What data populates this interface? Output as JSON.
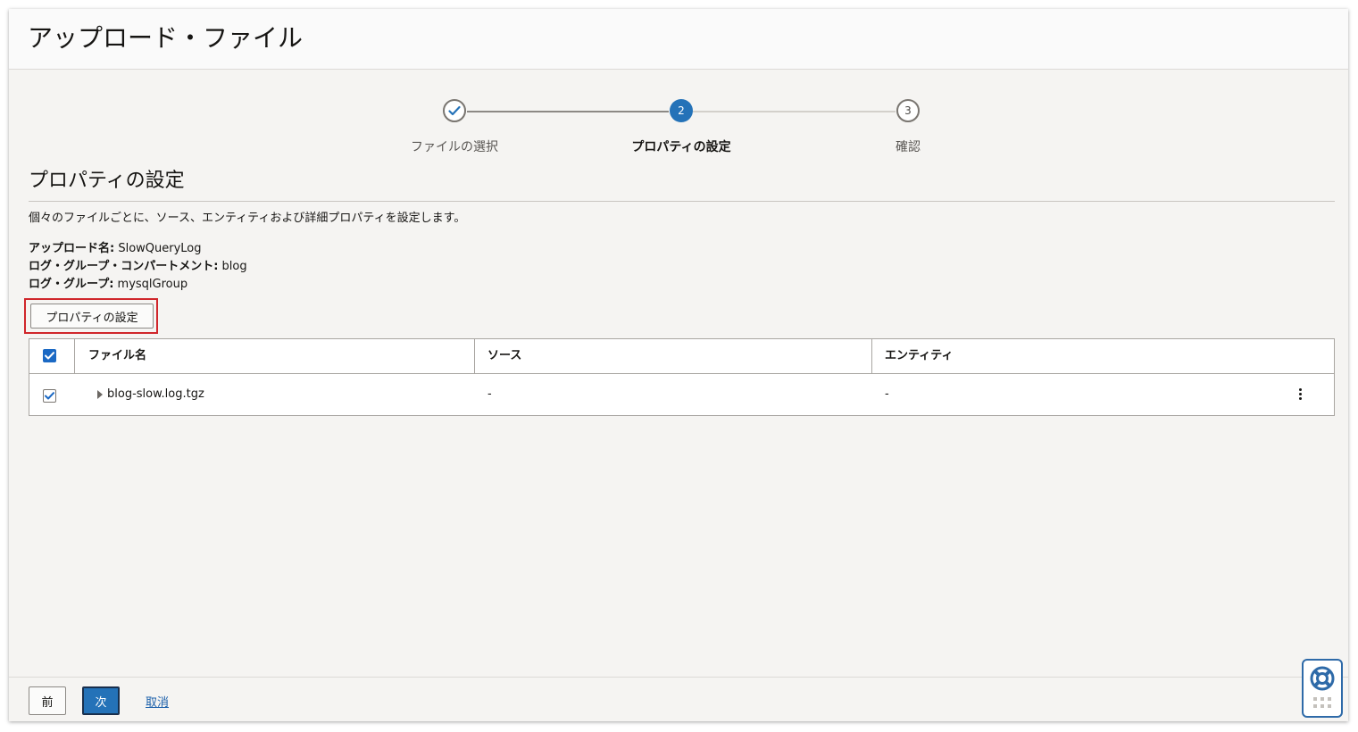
{
  "page": {
    "title": "アップロード・ファイル"
  },
  "stepper": {
    "steps": [
      {
        "label": "ファイルの選択",
        "state": "done"
      },
      {
        "label": "プロパティの設定",
        "state": "current",
        "number": "2"
      },
      {
        "label": "確認",
        "state": "todo",
        "number": "3"
      }
    ]
  },
  "section": {
    "title": "プロパティの設定",
    "description": "個々のファイルごとに、ソース、エンティティおよび詳細プロパティを設定します。"
  },
  "meta": {
    "upload_name_label": "アップロード名:",
    "upload_name_value": " SlowQueryLog",
    "compartment_label": "ログ・グループ・コンパートメント:",
    "compartment_value": " blog",
    "log_group_label": "ログ・グループ:",
    "log_group_value": " mysqlGroup"
  },
  "actions": {
    "set_properties_label": "プロパティの設定"
  },
  "table": {
    "columns": [
      "ファイル名",
      "ソース",
      "エンティティ"
    ],
    "header_checked": true,
    "rows": [
      {
        "checked": true,
        "file_name": "blog-slow.log.tgz",
        "source": "-",
        "entity": "-"
      }
    ]
  },
  "footer": {
    "prev_label": "前",
    "next_label": "次",
    "cancel_label": "取消"
  },
  "colors": {
    "accent": "#2472b8",
    "highlight": "#d0262b",
    "checkbox": "#1b69c4"
  },
  "icons": {
    "step_done": "check-icon",
    "expand": "caret-right-icon",
    "row_menu": "kebab-menu-icon",
    "help": "lifebuoy-icon"
  }
}
